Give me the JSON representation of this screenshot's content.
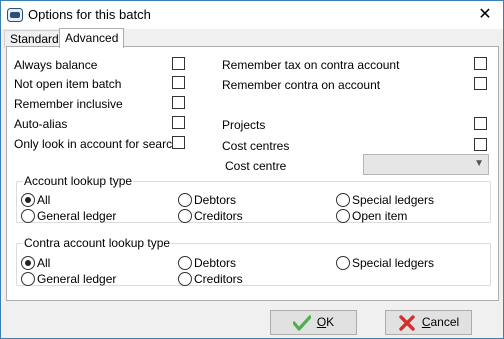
{
  "window": {
    "title": "Options for this batch",
    "close_glyph": "✕"
  },
  "tabs": [
    {
      "label": "Standard"
    },
    {
      "label": "Advanced"
    }
  ],
  "left_options": [
    {
      "label": "Always balance",
      "checked": false
    },
    {
      "label": "Not open item batch",
      "checked": false
    },
    {
      "label": "Remember inclusive",
      "checked": false
    },
    {
      "label": "Auto-alias",
      "checked": false
    },
    {
      "label": "Only look in account for search",
      "checked": false
    }
  ],
  "right_options": [
    {
      "label": "Remember tax on contra account",
      "checked": false
    },
    {
      "label": "Remember contra on account",
      "checked": false
    },
    {
      "label": "Projects",
      "checked": false
    },
    {
      "label": "Cost centres",
      "checked": false
    }
  ],
  "cost_centre": {
    "label": "Cost centre",
    "value": ""
  },
  "account_lookup": {
    "legend": "Account lookup type",
    "options": [
      "All",
      "Debtors",
      "Special ledgers",
      "General ledger",
      "Creditors",
      "Open item"
    ],
    "selected": "All"
  },
  "contra_lookup": {
    "legend": "Contra account lookup type",
    "options": [
      "All",
      "Debtors",
      "Special ledgers",
      "General ledger",
      "Creditors"
    ],
    "selected": "All"
  },
  "buttons": {
    "ok": {
      "label_first": "O",
      "label_rest": "K"
    },
    "cancel": {
      "label_first": "C",
      "label_rest": "ancel"
    }
  },
  "colors": {
    "accent_border": "#3c7fb1",
    "ok_icon": "#4caf50",
    "cancel_icon": "#d32f2f"
  }
}
